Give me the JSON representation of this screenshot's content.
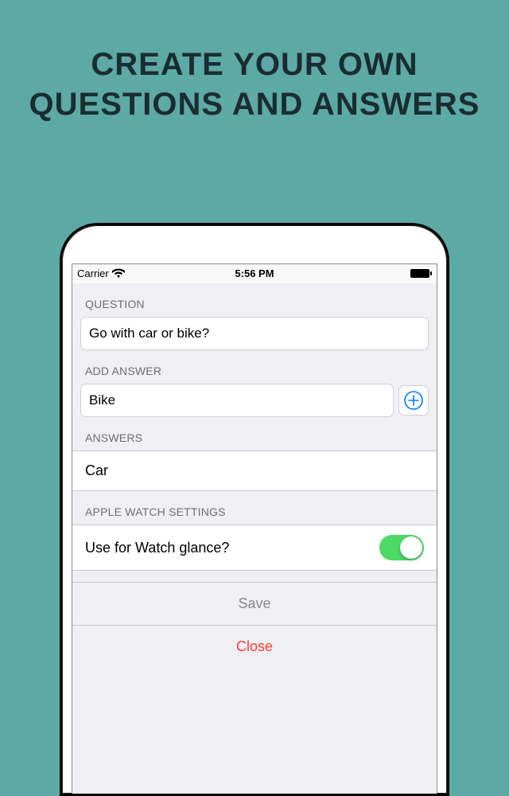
{
  "hero": {
    "line1": "CREATE YOUR OWN",
    "line2": "QUESTIONS AND ANSWERS"
  },
  "status_bar": {
    "carrier": "Carrier",
    "time": "5:56 PM"
  },
  "sections": {
    "question": {
      "header": "QUESTION",
      "value": "Go with car or bike?"
    },
    "add_answer": {
      "header": "ADD ANSWER",
      "value": "Bike"
    },
    "answers": {
      "header": "ANSWERS",
      "items": [
        "Car"
      ]
    },
    "watch": {
      "header": "APPLE WATCH SETTINGS",
      "label": "Use for Watch glance?",
      "on": true
    }
  },
  "buttons": {
    "save": "Save",
    "close": "Close"
  }
}
